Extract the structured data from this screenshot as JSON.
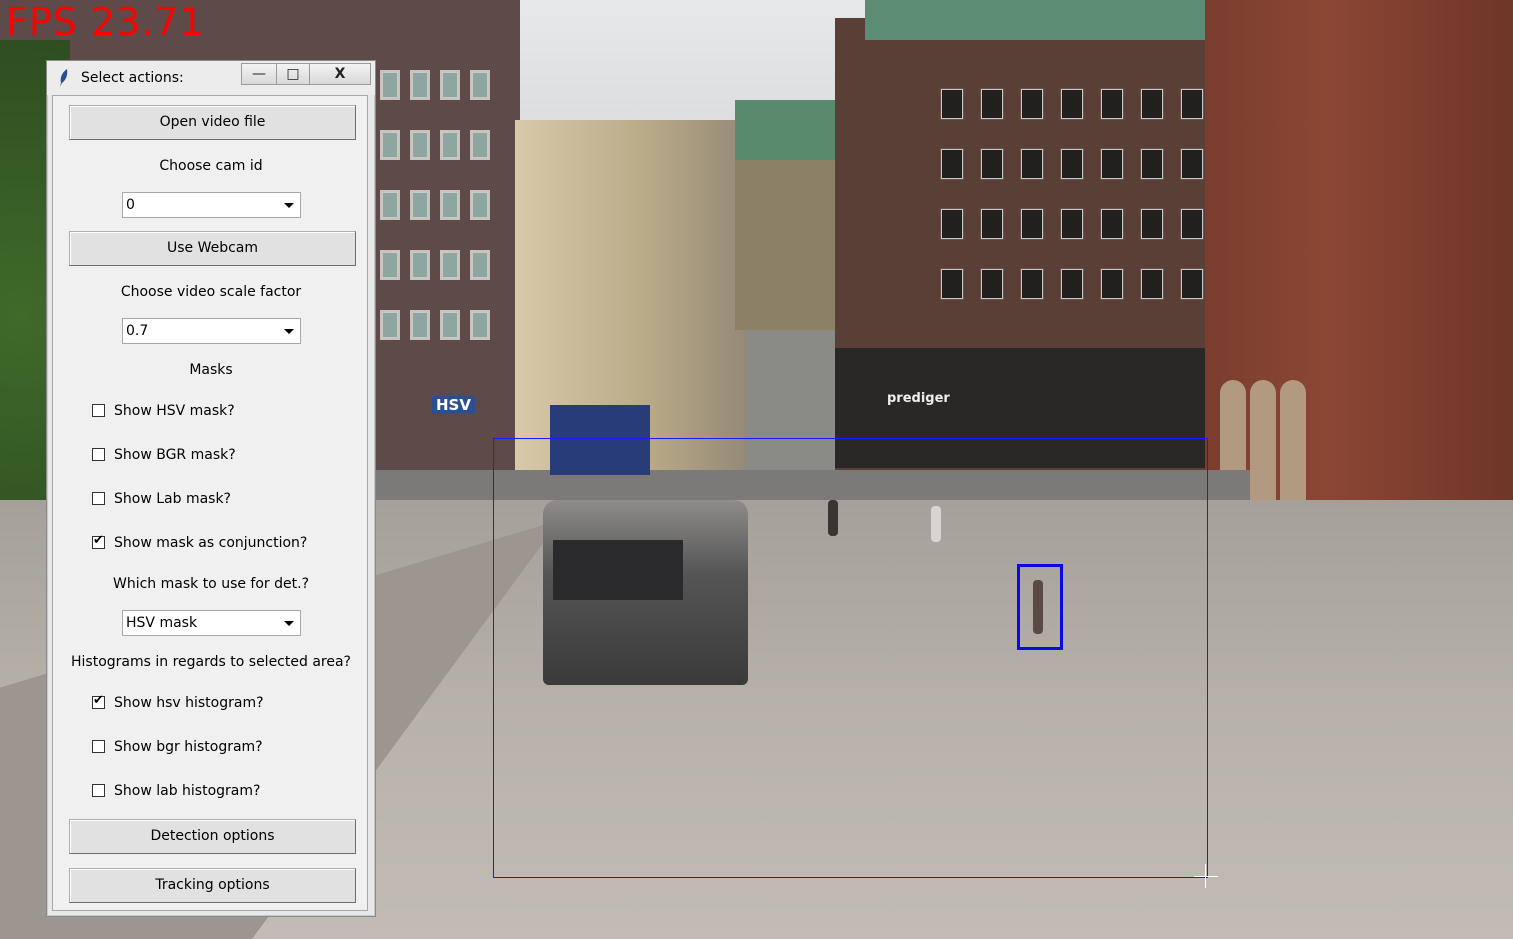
{
  "overlay": {
    "fps_text": "FPS  23.71",
    "video_signs": {
      "hsv": "HSV",
      "prediger": "prediger"
    }
  },
  "window": {
    "title": "Select actions:",
    "controls": {
      "minimize": "—",
      "maximize": "□",
      "close": "X"
    }
  },
  "panel": {
    "open_video_button": "Open video file",
    "choose_cam_label": "Choose cam id",
    "cam_id_value": "0",
    "use_webcam_button": "Use Webcam",
    "scale_factor_label": "Choose video scale factor",
    "scale_factor_value": "0.7",
    "masks_label": "Masks",
    "mask_checkboxes": [
      {
        "label": "Show HSV mask?",
        "checked": false
      },
      {
        "label": "Show BGR mask?",
        "checked": false
      },
      {
        "label": "Show Lab mask?",
        "checked": false
      },
      {
        "label": "Show mask as conjunction?",
        "checked": true
      }
    ],
    "which_mask_label": "Which mask to use for det.?",
    "which_mask_value": "HSV mask",
    "histograms_label": "Histograms in regards to selected area?",
    "histogram_checkboxes": [
      {
        "label": "Show hsv histogram?",
        "checked": true
      },
      {
        "label": "Show bgr histogram?",
        "checked": false
      },
      {
        "label": "Show lab histogram?",
        "checked": false
      }
    ],
    "detection_options_button": "Detection options",
    "tracking_options_button": "Tracking options",
    "check_glyph": "✔"
  },
  "colors": {
    "fps_text": "#ff0000",
    "selection_rectangle": "#1a1aff",
    "detection_box": "#0a0ae6"
  }
}
